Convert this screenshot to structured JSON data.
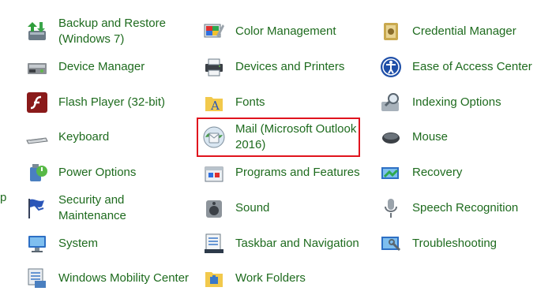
{
  "edge_text": "p",
  "items": [
    {
      "label": "Backup and Restore (Windows 7)",
      "icon": "backup-restore-icon"
    },
    {
      "label": "Color Management",
      "icon": "color-management-icon"
    },
    {
      "label": "Credential Manager",
      "icon": "credential-manager-icon"
    },
    {
      "label": "Device Manager",
      "icon": "device-manager-icon"
    },
    {
      "label": "Devices and Printers",
      "icon": "devices-printers-icon"
    },
    {
      "label": "Ease of Access Center",
      "icon": "ease-of-access-icon"
    },
    {
      "label": "Flash Player (32-bit)",
      "icon": "flash-player-icon"
    },
    {
      "label": "Fonts",
      "icon": "fonts-icon"
    },
    {
      "label": "Indexing Options",
      "icon": "indexing-options-icon"
    },
    {
      "label": "Keyboard",
      "icon": "keyboard-icon"
    },
    {
      "label": "Mail (Microsoft Outlook 2016)",
      "icon": "mail-icon"
    },
    {
      "label": "Mouse",
      "icon": "mouse-icon"
    },
    {
      "label": "Power Options",
      "icon": "power-options-icon"
    },
    {
      "label": "Programs and Features",
      "icon": "programs-features-icon"
    },
    {
      "label": "Recovery",
      "icon": "recovery-icon"
    },
    {
      "label": "Security and Maintenance",
      "icon": "security-flag-icon"
    },
    {
      "label": "Sound",
      "icon": "speaker-icon"
    },
    {
      "label": "Speech Recognition",
      "icon": "microphone-icon"
    },
    {
      "label": "System",
      "icon": "system-monitor-icon"
    },
    {
      "label": "Taskbar and Navigation",
      "icon": "taskbar-icon"
    },
    {
      "label": "Troubleshooting",
      "icon": "troubleshooting-icon"
    },
    {
      "label": "Windows Mobility Center",
      "icon": "mobility-center-icon"
    },
    {
      "label": "Work Folders",
      "icon": "work-folders-icon"
    }
  ],
  "colors": {
    "link": "#1e6b1e",
    "highlight": "#e0141e"
  }
}
